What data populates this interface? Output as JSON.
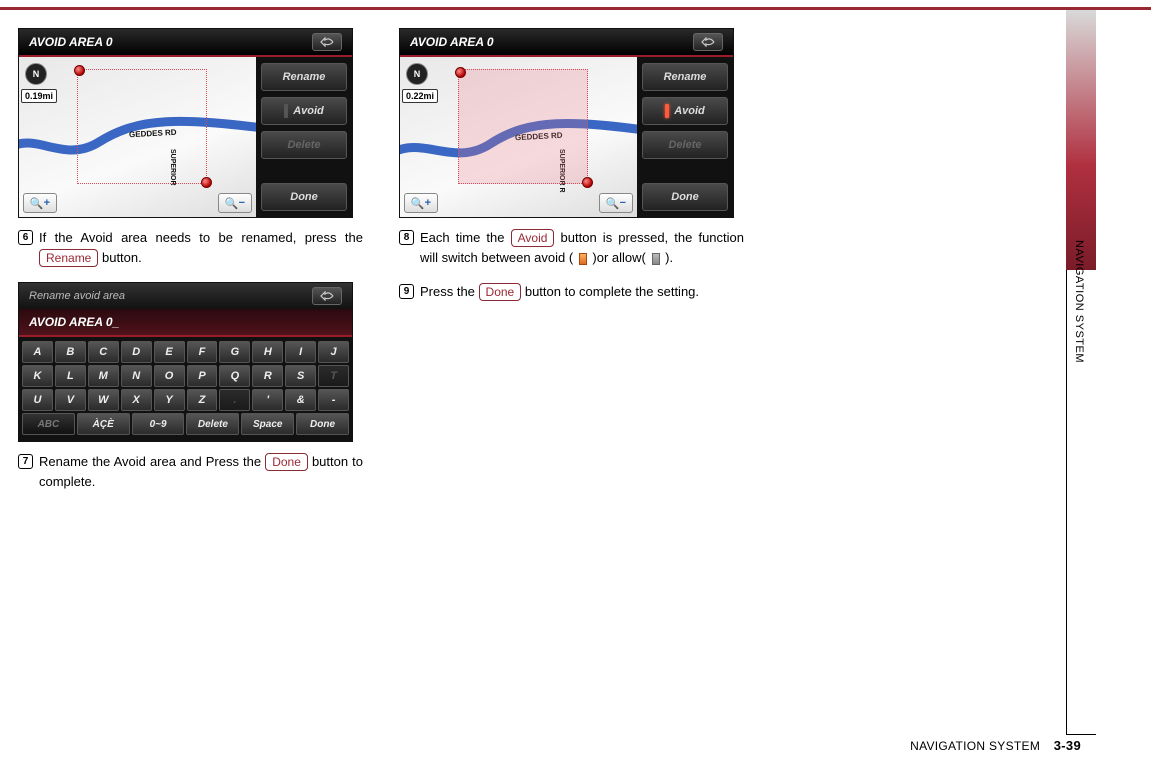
{
  "section_tab": "NAVIGATION SYSTEM",
  "footer_section": "NAVIGATION SYSTEM",
  "page_number": "3-39",
  "colors": {
    "accent": "#9a2834"
  },
  "screenshot1": {
    "title": "AVOID AREA 0",
    "distance": "0.19mi",
    "road_h": "GEDDES RD",
    "road_v": "SUPERIOR",
    "buttons": {
      "rename": "Rename",
      "avoid": "Avoid",
      "delete": "Delete",
      "done": "Done"
    },
    "avoid_indicator": "off",
    "zoom_in": "+",
    "zoom_out": "−",
    "compass": "N"
  },
  "screenshot2_keyboard": {
    "header": "Rename avoid area",
    "entry": "AVOID AREA 0_",
    "row1": [
      "A",
      "B",
      "C",
      "D",
      "E",
      "F",
      "G",
      "H",
      "I",
      "J"
    ],
    "row2": [
      "K",
      "L",
      "M",
      "N",
      "O",
      "P",
      "Q",
      "R",
      "S",
      "T"
    ],
    "row3": [
      "U",
      "V",
      "W",
      "X",
      "Y",
      "Z",
      ".",
      "'",
      "&",
      "-"
    ],
    "row4": [
      "ABC",
      "ÀÇÈ",
      "0~9",
      "Delete",
      "Space",
      "Done"
    ]
  },
  "screenshot3": {
    "title": "AVOID AREA 0",
    "distance": "0.22mi",
    "road_h": "GEDDES RD",
    "road_v": "SUPERIOR R",
    "buttons": {
      "rename": "Rename",
      "avoid": "Avoid",
      "delete": "Delete",
      "done": "Done"
    },
    "avoid_indicator": "on",
    "zoom_in": "+",
    "zoom_out": "−",
    "compass": "N"
  },
  "steps": {
    "s6": {
      "num": "6",
      "pre": "If the Avoid area needs to be renamed, press the ",
      "btn": "Rename",
      "post": " button."
    },
    "s7": {
      "num": "7",
      "pre": "Rename the Avoid area and Press the ",
      "btn": "Done",
      "post": " button to complete."
    },
    "s8": {
      "num": "8",
      "pre": "Each time the ",
      "btn": "Avoid",
      "mid": " button is pressed, the function will switch between avoid ( ",
      "post1": " )or allow( ",
      "post2": " )."
    },
    "s9": {
      "num": "9",
      "pre": "Press the ",
      "btn": "Done",
      "post": " button to complete the setting."
    }
  }
}
